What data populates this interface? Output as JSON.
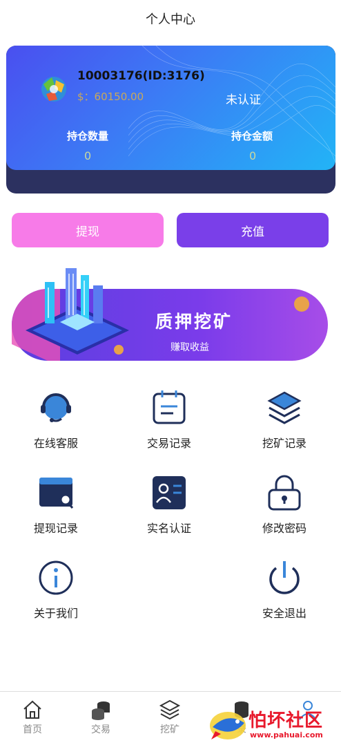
{
  "header": {
    "title": "个人中心"
  },
  "account": {
    "name": "10003176(ID:3176)",
    "balance": "$：60150.00",
    "auth_status": "未认证",
    "position_count_label": "持仓数量",
    "position_count_value": "0",
    "position_amount_label": "持仓金额",
    "position_amount_value": "0"
  },
  "actions": {
    "withdraw": "提现",
    "recharge": "充值"
  },
  "banner": {
    "title": "质押挖矿",
    "subtitle": "赚取收益"
  },
  "menu": [
    {
      "label": "在线客服",
      "icon": "headset-icon"
    },
    {
      "label": "交易记录",
      "icon": "notepad-icon"
    },
    {
      "label": "挖矿记录",
      "icon": "layers-icon"
    },
    {
      "label": "提现记录",
      "icon": "card-search-icon"
    },
    {
      "label": "实名认证",
      "icon": "id-card-icon"
    },
    {
      "label": "修改密码",
      "icon": "lock-icon"
    },
    {
      "label": "关于我们",
      "icon": "info-icon"
    },
    {
      "label": "安全退出",
      "icon": "power-icon"
    }
  ],
  "nav": [
    {
      "label": "首页",
      "icon": "home-icon"
    },
    {
      "label": "交易",
      "icon": "coins-icon"
    },
    {
      "label": "挖矿",
      "icon": "layers-icon"
    },
    {
      "label": "录",
      "icon": "coins-icon"
    },
    {
      "label": "",
      "icon": "user-icon"
    }
  ],
  "watermark": {
    "text": "怕坏社区",
    "url": "www.pahuai.com"
  },
  "colors": {
    "accent": "#3b7cf5",
    "pink": "#f77be8",
    "purple": "#7a3fe9",
    "icon": "#2a3a6e"
  }
}
